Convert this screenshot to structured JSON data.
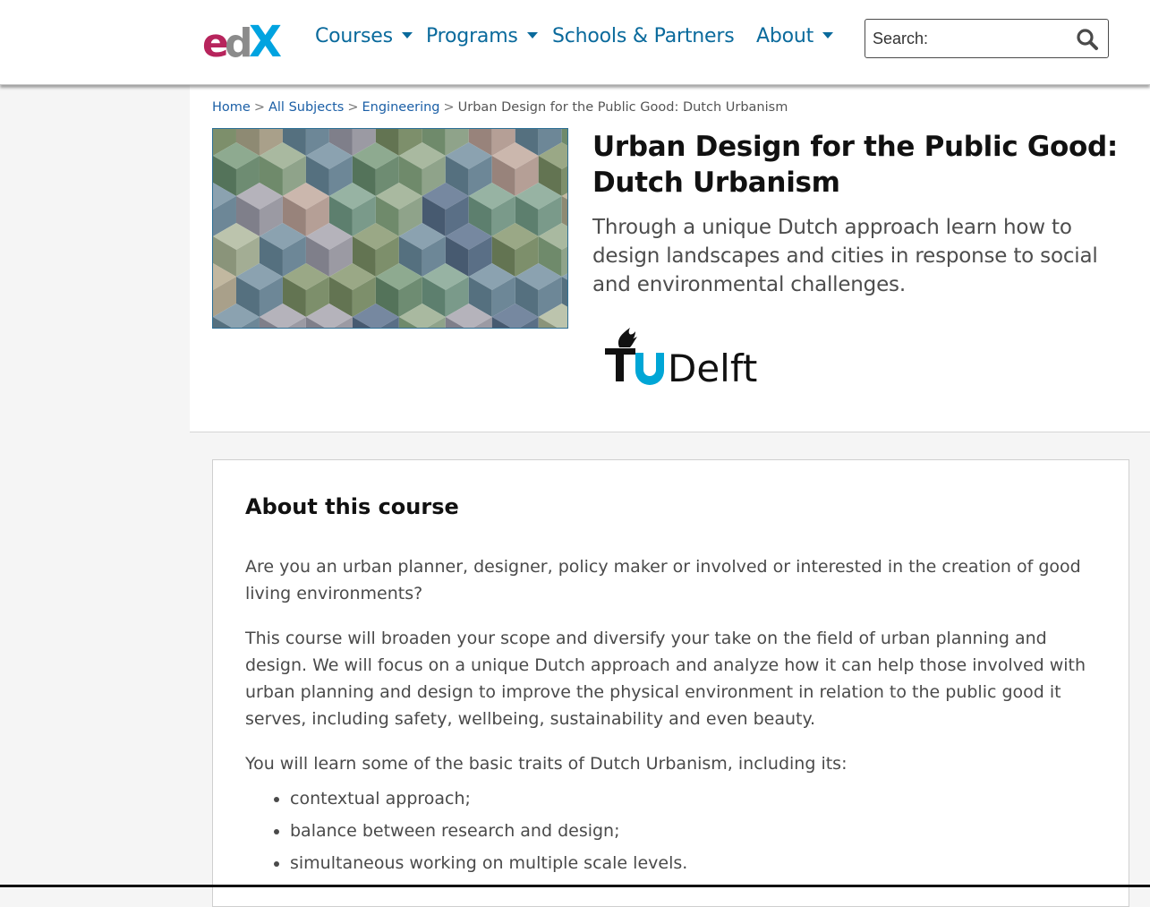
{
  "header": {
    "logo_alt": "edX",
    "nav": [
      {
        "label": "Courses",
        "dropdown": true
      },
      {
        "label": "Programs",
        "dropdown": true
      },
      {
        "label": "Schools & Partners",
        "dropdown": false
      },
      {
        "label": "About",
        "dropdown": true
      }
    ],
    "search": {
      "placeholder": "Search:",
      "icon": "search-icon"
    }
  },
  "breadcrumb": {
    "items": [
      "Home",
      "All Subjects",
      "Engineering"
    ],
    "current": "Urban Design for the Public Good: Dutch Urbanism",
    "separator": ">"
  },
  "course": {
    "title": "Urban Design for the Public Good: Dutch Urbanism",
    "subtitle": "Through a unique Dutch approach learn how to design landscapes and cities in response to social and environmental challenges.",
    "partner_logo_text": "TUDelft"
  },
  "about": {
    "heading": "About this course",
    "paragraphs": [
      "Are you an urban planner, designer, policy maker or involved or interested in the creation of good living environments?",
      "This course will broaden your scope and diversify your take on the field of urban planning and design. We will focus on a unique Dutch approach and analyze how it can help those involved with urban planning and design to improve the physical environment in relation to the public good it serves, including safety, wellbeing, sustainability and even beauty.",
      "You will learn some of the basic traits of Dutch Urbanism, including its:"
    ],
    "bullets": [
      "contextual approach;",
      "balance between research and design;",
      "simultaneous working on multiple scale levels."
    ]
  },
  "colors": {
    "link": "#0a6a9c",
    "brand_magenta": "#b7245c",
    "brand_gray": "#8b8b8b",
    "brand_blue": "#00a3e0",
    "tudelft_blue": "#00a6d6"
  }
}
